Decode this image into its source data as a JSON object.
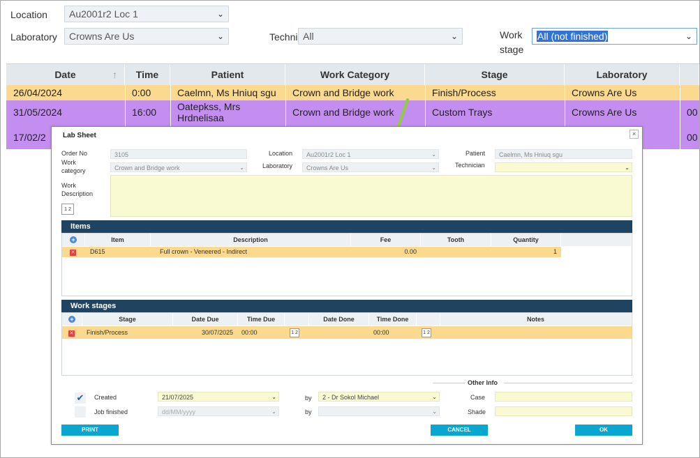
{
  "filters": {
    "location_label": "Location",
    "location_value": "Au2001r2 Loc 1",
    "laboratory_label": "Laboratory",
    "laboratory_value": "Crowns Are Us",
    "technician_label": "Techni",
    "technician_value": "All",
    "work_stage_label_1": "Work",
    "work_stage_label_2": "stage",
    "work_stage_value": "All (not finished)"
  },
  "grid": {
    "headers": [
      "Date",
      "Time",
      "Patient",
      "Work Category",
      "Stage",
      "Laboratory"
    ],
    "rows": [
      {
        "date": "26/04/2024",
        "time": "0:00",
        "patient": "Caelmn, Ms Hniuq sgu",
        "category": "Crown and Bridge work",
        "stage": "Finish/Process",
        "lab": "Crowns Are Us",
        "extra": ""
      },
      {
        "date": "31/05/2024",
        "time": "16:00",
        "patient": "Oatepkss, Mrs",
        "patient2": "Hrdnelisaa",
        "category": "Crown and Bridge work",
        "stage": "Custom Trays",
        "lab": "Crowns Are Us",
        "extra": "00"
      },
      {
        "date": "17/02/2",
        "extra": "00"
      }
    ]
  },
  "dialog": {
    "title": "Lab Sheet",
    "close": "×",
    "order_no_label": "Order No",
    "order_no": "3105",
    "work_category_label_1": "Work",
    "work_category_label_2": "category",
    "work_category": "Crown and Bridge work",
    "location_label": "Location",
    "location": "Au2001r2 Loc 1",
    "laboratory_label": "Laboratory",
    "laboratory": "Crowns Are Us",
    "patient_label": "Patient",
    "patient": "Caelmn, Ms Hniuq sgu",
    "technician_label": "Technician",
    "technician": "",
    "work_desc_label_1": "Work",
    "work_desc_label_2": "Description",
    "items_title": "Items",
    "items_headers": [
      "Item",
      "Description",
      "Fee",
      "Tooth",
      "Quantity"
    ],
    "items_row": {
      "item": "D615",
      "description": "Full crown - Veneered - Indirect",
      "fee": "0.00",
      "tooth": "",
      "quantity": "1"
    },
    "stages_title": "Work stages",
    "stages_headers": [
      "Stage",
      "Date Due",
      "Time Due",
      "Date Done",
      "Time Done",
      "Notes"
    ],
    "stages_row": {
      "stage": "Finish/Process",
      "date_due": "30/07/2025",
      "time_due": "00:00",
      "date_done": "",
      "time_done": "00:00",
      "notes": ""
    },
    "other_info_title": "Other Info",
    "created_label": "Created",
    "created_date": "21/07/2025",
    "by_label": "by",
    "created_by": "2 - Dr Sokol Michael",
    "job_finished_label": "Job finished",
    "job_finished_placeholder": "dd/MM/yyyy",
    "job_by": "",
    "case_label": "Case",
    "shade_label": "Shade",
    "print_btn": "PRINT",
    "cancel_btn": "CANCEL",
    "ok_btn": "OK",
    "cal_glyph": "1 2"
  },
  "colors": {
    "row_yellow": "#fbd98e",
    "row_purple": "#c48ef0",
    "section_header": "#1f4462",
    "button": "#09a7cf",
    "arrow": "#8ccf3a"
  }
}
